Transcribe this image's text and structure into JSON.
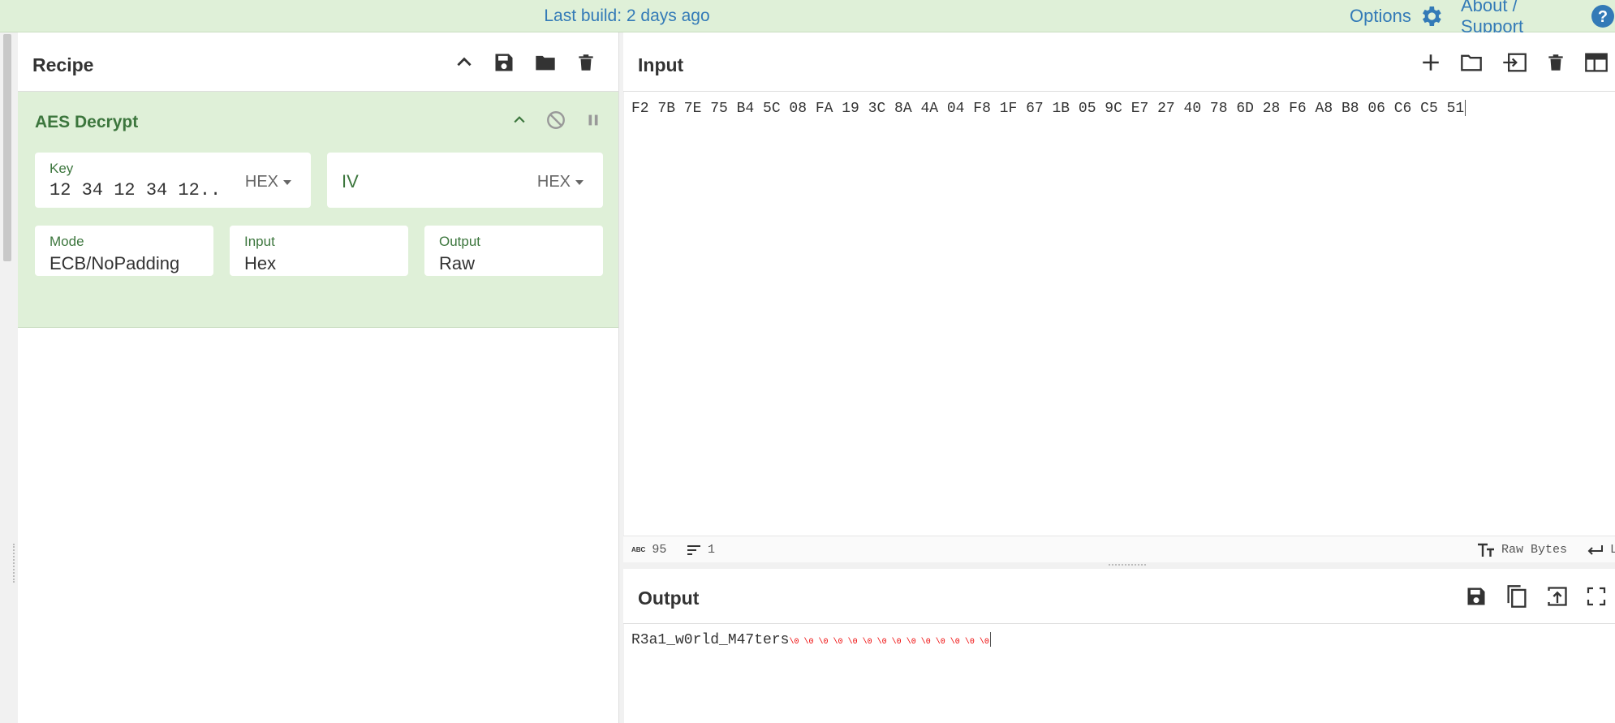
{
  "topbar": {
    "build_text": "Last build: 2 days ago",
    "options_label": "Options",
    "about_label": "About / Support"
  },
  "recipe": {
    "title": "Recipe",
    "operation": {
      "name": "AES Decrypt",
      "key": {
        "label": "Key",
        "value": "12 34 12 34 12...",
        "format": "HEX"
      },
      "iv": {
        "placeholder": "IV",
        "format": "HEX"
      },
      "mode": {
        "label": "Mode",
        "value": "ECB/NoPadding"
      },
      "input": {
        "label": "Input",
        "value": "Hex"
      },
      "output": {
        "label": "Output",
        "value": "Raw"
      }
    }
  },
  "input_pane": {
    "title": "Input",
    "text": "F2 7B 7E 75 B4 5C 08 FA 19 3C 8A 4A 04 F8 1F 67 1B 05 9C E7 27 40 78 6D 28 F6 A8 B8 06 C6 C5 51",
    "status": {
      "abc_icon_text": "ABC",
      "char_count": "95",
      "line_count": "1",
      "encoding_label": "Raw Bytes",
      "eol_label": "L"
    }
  },
  "output_pane": {
    "title": "Output",
    "text": "R3a1_w0rld_M47ters",
    "control_chars": [
      "\\0",
      "\\0",
      "\\0",
      "\\0",
      "\\0",
      "\\0",
      "\\0",
      "\\0",
      "\\0",
      "\\0",
      "\\0",
      "\\0",
      "\\0",
      "\\0"
    ]
  },
  "colors": {
    "accent_green": "#3c763d",
    "header_bg": "#dff0d8",
    "link_blue": "#337ab7",
    "null_char_red": "#ee0000"
  },
  "icons": {
    "topbar": [
      "gear-icon",
      "help-icon"
    ],
    "recipe_header": [
      "chevron-up-icon",
      "save-icon",
      "folder-icon",
      "trash-icon"
    ],
    "operation_controls": [
      "chevron-up-icon",
      "disable-icon",
      "pause-icon"
    ],
    "input_header": [
      "plus-icon",
      "folder-icon",
      "import-icon",
      "trash-icon",
      "layout-icon"
    ],
    "output_header": [
      "save-icon",
      "copy-icon",
      "export-icon",
      "maximize-icon"
    ]
  }
}
